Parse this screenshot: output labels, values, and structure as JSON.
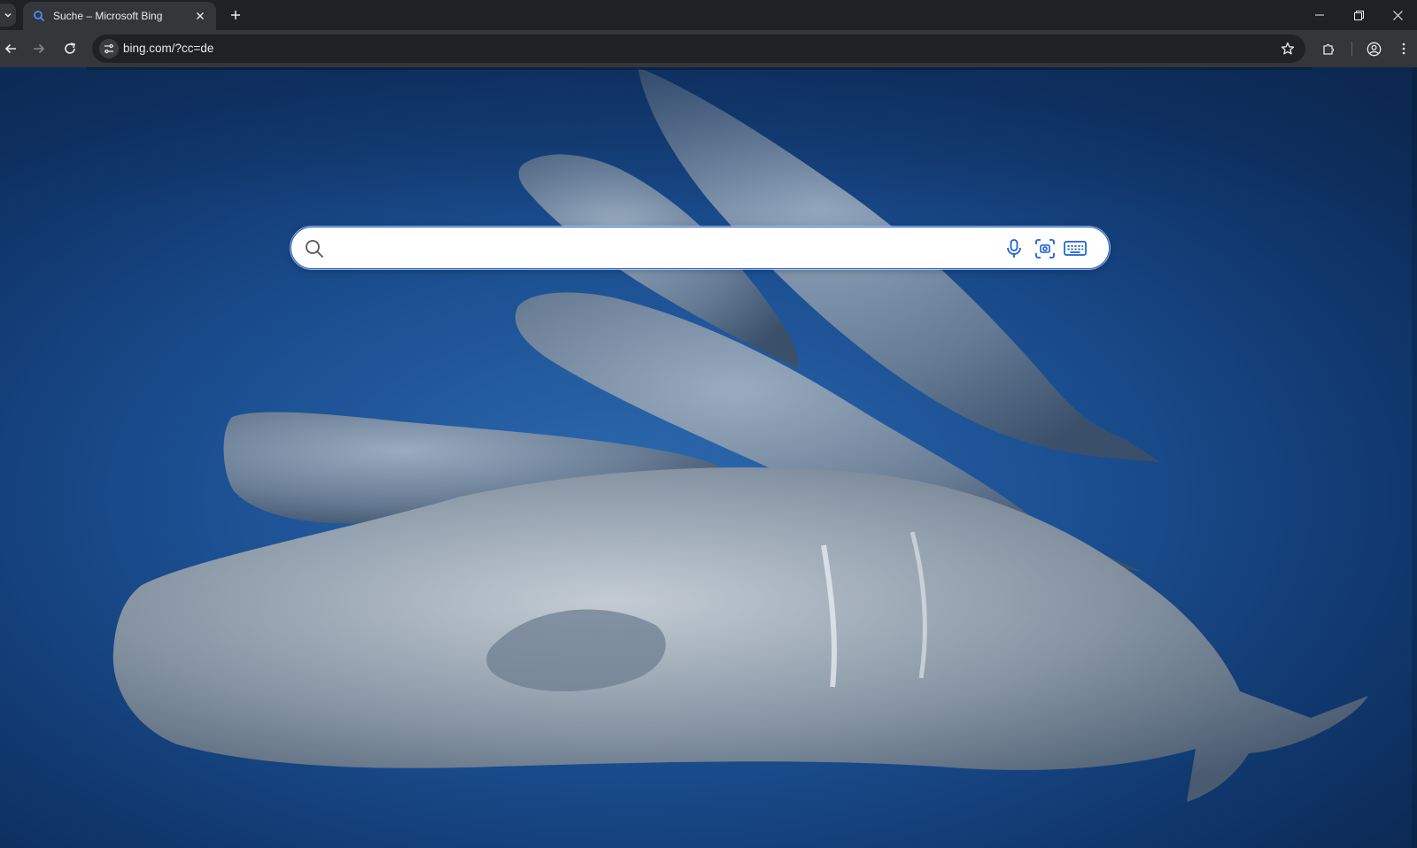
{
  "browser": {
    "tab": {
      "title": "Suche – Microsoft Bing",
      "favicon": "bing-search-icon"
    },
    "address_bar": {
      "url": "bing.com/?cc=de"
    },
    "icons": {
      "tab_list": "chevron-down-icon",
      "tab_close": "close-icon",
      "new_tab": "plus-icon",
      "back": "arrow-left-icon",
      "forward": "arrow-right-icon",
      "reload": "reload-icon",
      "site_info": "tune-icon",
      "bookmark": "star-icon",
      "extensions": "puzzle-icon",
      "profile": "profile-icon",
      "menu": "kebab-menu-icon",
      "minimize": "minimize-icon",
      "restore": "restore-icon",
      "close_window": "close-icon"
    }
  },
  "page": {
    "search": {
      "value": "",
      "placeholder": "",
      "icons": [
        "search-icon",
        "microphone-icon",
        "visual-search-icon",
        "keyboard-icon"
      ]
    },
    "background": "underwater photo of a pod of sperm whales"
  },
  "colors": {
    "accent": "#1a5fd6",
    "tabstrip_bg": "#202124",
    "toolbar_bg": "#35363a",
    "ocean": "#1b4f91"
  }
}
